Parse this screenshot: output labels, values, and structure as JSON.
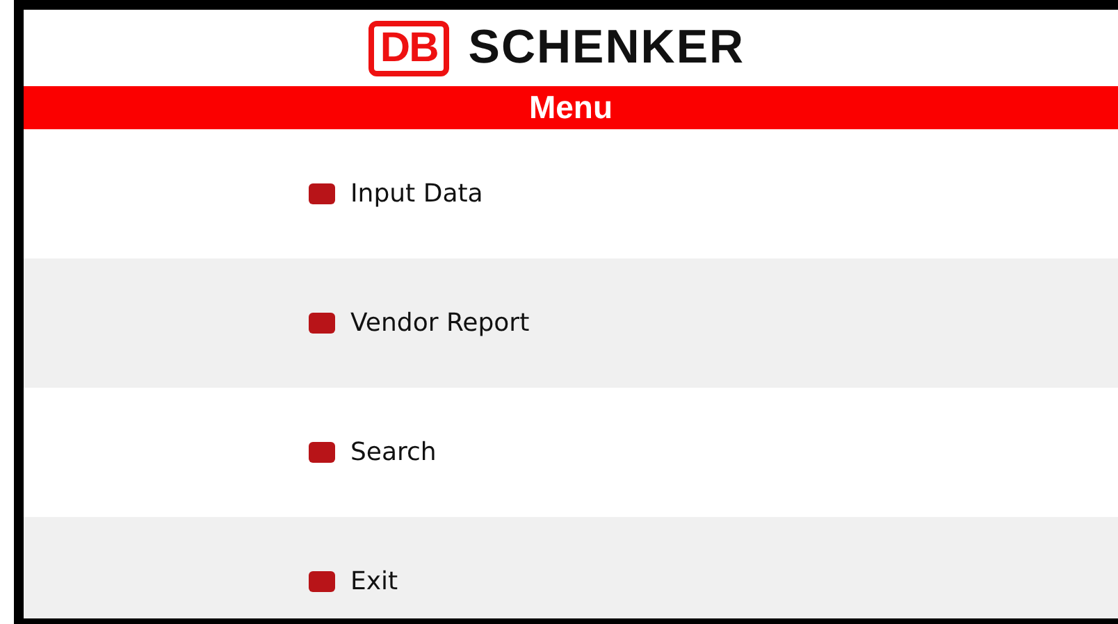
{
  "logo": {
    "mark": "DB",
    "name": "SCHENKER"
  },
  "title": "Menu",
  "menu_items": [
    {
      "label": "Input Data"
    },
    {
      "label": "Vendor Report"
    },
    {
      "label": "Search"
    },
    {
      "label": "Exit"
    }
  ]
}
